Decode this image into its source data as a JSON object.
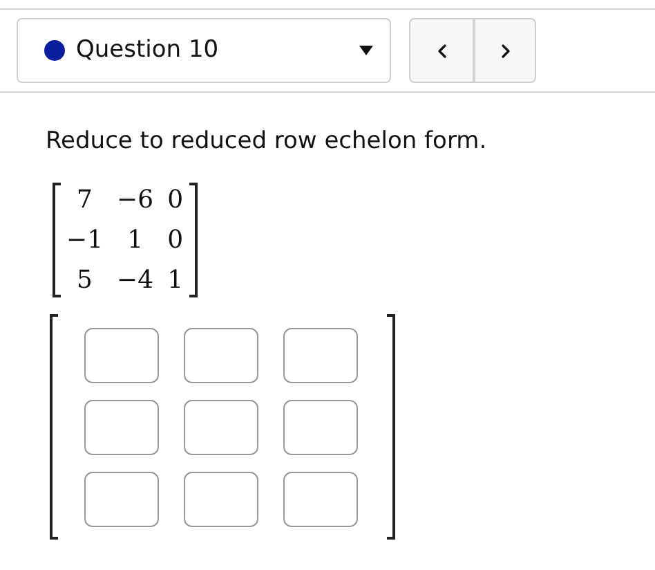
{
  "question_select": {
    "label": "Question 10"
  },
  "nav_buttons": [
    {
      "kind": "prev"
    },
    {
      "kind": "next"
    }
  ],
  "prompt": "Reduce to reduced row echelon form.",
  "matrix": [
    [
      "7",
      "−6",
      "0"
    ],
    [
      "−1",
      "1",
      "0"
    ],
    [
      "5",
      "−4",
      "1"
    ]
  ],
  "answer_matrix": [
    [
      {
        "kind": "input"
      },
      {
        "kind": "input"
      },
      {
        "kind": "input"
      }
    ],
    [
      {
        "kind": "input"
      },
      {
        "kind": "input"
      },
      {
        "kind": "input"
      }
    ],
    [
      {
        "kind": "input"
      },
      {
        "kind": "input"
      },
      {
        "kind": "input"
      }
    ]
  ]
}
